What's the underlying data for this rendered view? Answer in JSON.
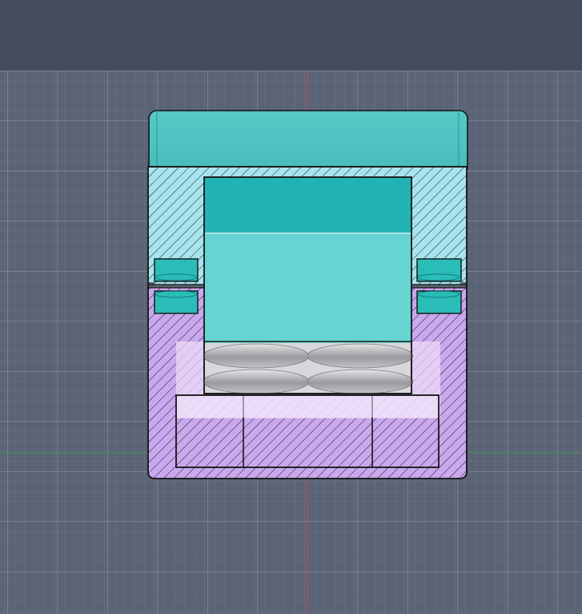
{
  "viewport": {
    "background_color": "#5a6476",
    "grid_minor_color": "#6b7587",
    "grid_major_color": "#8a94a6",
    "axis_x_color": "#4c8a5a",
    "axis_y_color": "#b8465a"
  },
  "model": {
    "icons": [
      "section-view-model"
    ],
    "colors": {
      "cap_fill": "#4ec4c2",
      "upper_section_fill": "#a8e4ee",
      "lower_section_fill": "#c9a8ee",
      "cavity_top_fill": "#22b4b4",
      "cavity_fill": "#66d4d2",
      "magnet_fill": "#2abdb8",
      "disc_fill": "#c8c8cc",
      "outline": "#141414"
    }
  }
}
